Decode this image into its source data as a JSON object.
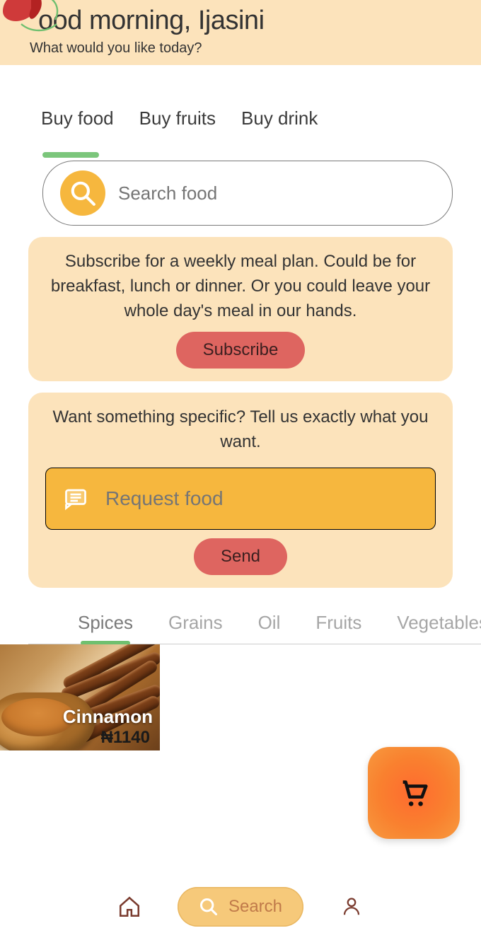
{
  "header": {
    "greeting": "ood morning, Ijasini",
    "sub": "What would you like today?"
  },
  "topTabs": [
    "Buy food",
    "Buy fruits",
    "Buy drink"
  ],
  "activeTopTab": 0,
  "search": {
    "placeholder": "Search food"
  },
  "subscribeCard": {
    "text": "Subscribe for a weekly meal plan. Could be for breakfast, lunch or dinner. Or you could leave your whole day's meal in our hands.",
    "button": "Subscribe"
  },
  "requestCard": {
    "text": "Want something specific? Tell us exactly what you want.",
    "placeholder": "Request food",
    "button": "Send"
  },
  "categories": [
    "Spices",
    "Grains",
    "Oil",
    "Fruits",
    "Vegetables"
  ],
  "activeCategory": 0,
  "products": [
    {
      "name": "Cinnamon",
      "price": "₦1140"
    }
  ],
  "bottomNav": {
    "searchLabel": "Search"
  }
}
